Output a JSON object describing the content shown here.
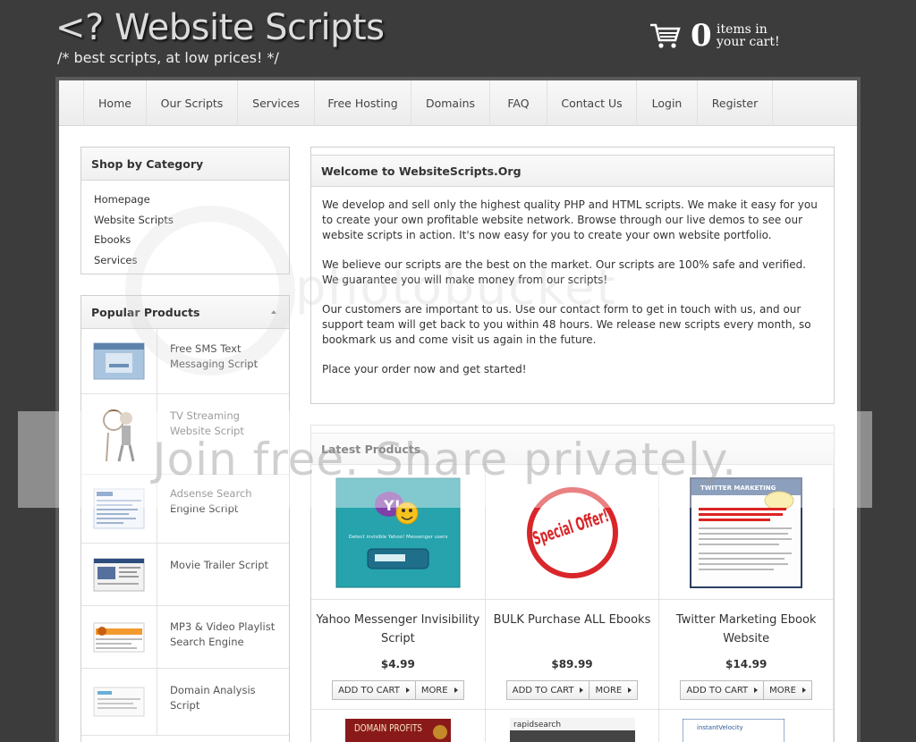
{
  "header": {
    "logo_title": "<? Website Scripts",
    "logo_subtitle": "/* best scripts, at low prices! */",
    "cart_count": "0",
    "cart_text_line1": "items in",
    "cart_text_line2": "your cart!"
  },
  "nav": {
    "items": [
      {
        "label": "Home"
      },
      {
        "label": "Our Scripts"
      },
      {
        "label": "Services"
      },
      {
        "label": "Free Hosting"
      },
      {
        "label": "Domains"
      },
      {
        "label": "FAQ"
      },
      {
        "label": "Contact Us"
      },
      {
        "label": "Login"
      },
      {
        "label": "Register"
      }
    ]
  },
  "sidebar": {
    "category_title": "Shop by Category",
    "categories": [
      {
        "label": "Homepage"
      },
      {
        "label": "Website Scripts"
      },
      {
        "label": "Ebooks"
      },
      {
        "label": "Services"
      }
    ],
    "popular_title": "Popular Products",
    "popular": [
      {
        "name": "Free SMS Text Messaging Script"
      },
      {
        "name": "TV Streaming Website Script"
      },
      {
        "name": "Adsense Search Engine Script"
      },
      {
        "name": "Movie Trailer Script"
      },
      {
        "name": "MP3 & Video Playlist Search Engine"
      },
      {
        "name": "Domain Analysis Script"
      }
    ]
  },
  "welcome": {
    "title": "Welcome to WebsiteScripts.Org",
    "paragraphs": [
      "We develop and sell only the highest quality PHP and HTML scripts. We make it easy for you to create your own profitable website network. Browse through our live demos to see our website scripts in action. It's now easy for you to create your own website portfolio.",
      "We believe our scripts are the best on the market. Our scripts are 100% safe and verified. We guarantee you will make money from our scripts!",
      "Our customers are important to us. Use our contact form to get in touch with us, and our support team will get back to you within 48 hours. We release new scripts every month, so bookmark us and come visit us again in the future.",
      "Place your order now and get started!"
    ]
  },
  "latest": {
    "title": "Latest Products",
    "add_to_cart_label": "ADD TO CART",
    "more_label": "MORE",
    "products": [
      {
        "name": "Yahoo Messenger Invisibility Script",
        "price": "$4.99",
        "image_caption": "Detect invisible Yahoo! Messenger users"
      },
      {
        "name": "BULK Purchase ALL Ebooks",
        "price": "$89.99",
        "image_text": "Special Offer!"
      },
      {
        "name": "Twitter Marketing Ebook Website",
        "price": "$14.99",
        "image_text": "TWITTER MARKETING"
      }
    ],
    "row2": [
      {
        "image_text": "DOMAIN PROFITS"
      },
      {
        "image_text": "rapidsearch"
      },
      {
        "image_text": "instantVelocity"
      }
    ]
  },
  "watermark": {
    "text": "Join free. Share privately.",
    "logo_text": "photobucket"
  },
  "colors": {
    "background": "#3c3c3c",
    "panel": "#ffffff",
    "border": "#cfcfcf",
    "text": "#333333"
  }
}
